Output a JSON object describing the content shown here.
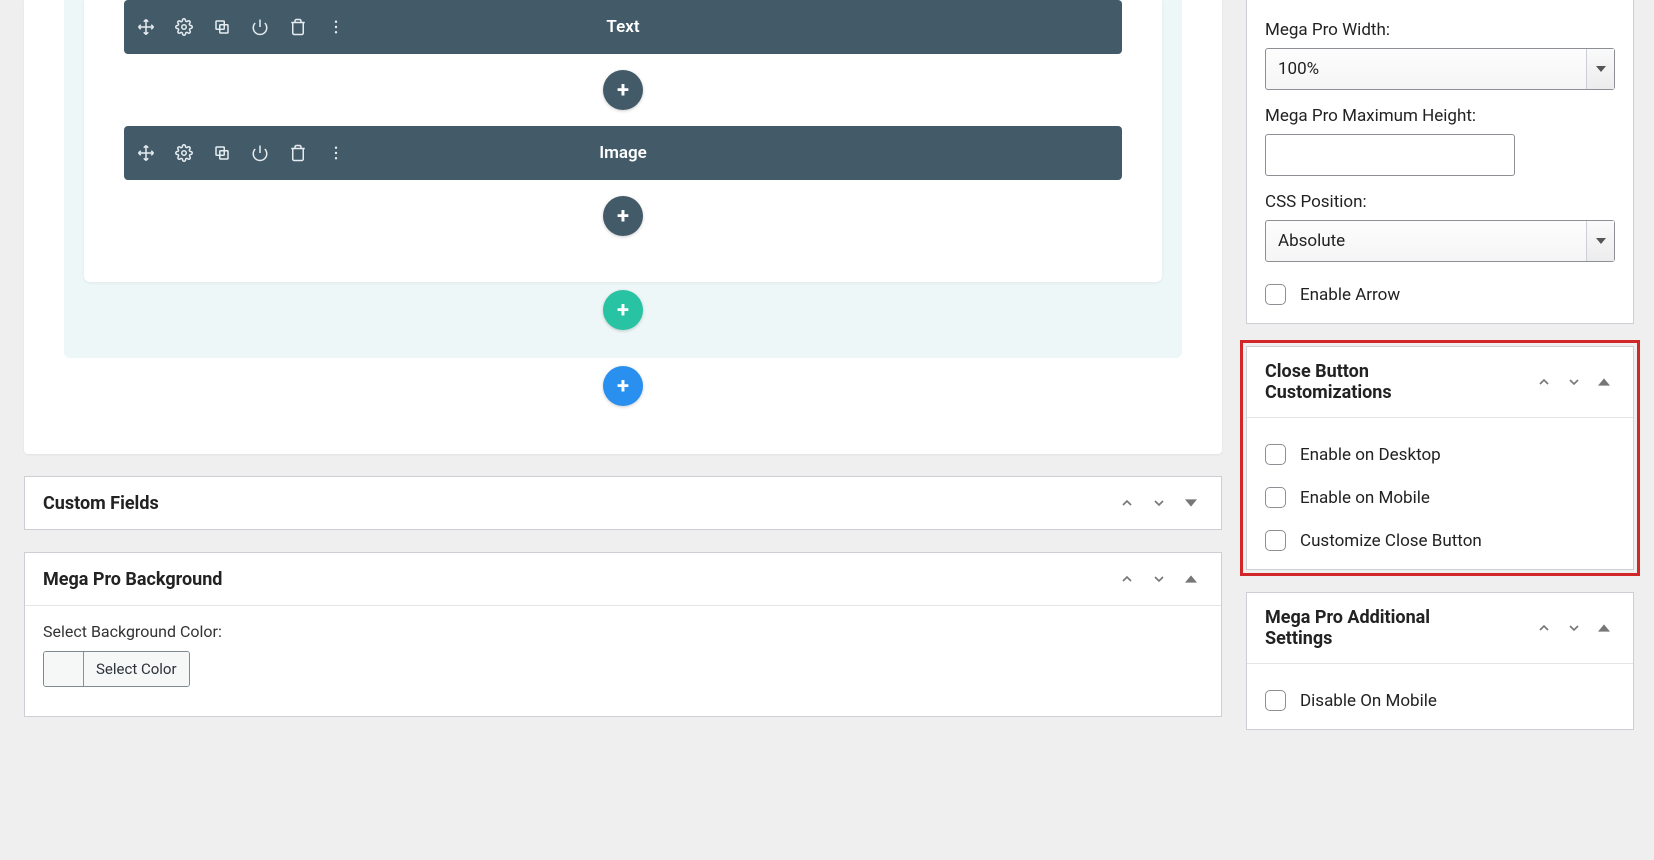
{
  "canvas": {
    "blocks": [
      {
        "label": "Text"
      },
      {
        "label": "Image"
      }
    ]
  },
  "metaboxes": {
    "custom_fields": {
      "title": "Custom Fields"
    },
    "mega_pro_bg": {
      "title": "Mega Pro Background",
      "field_label": "Select Background Color:",
      "color_button": "Select Color"
    }
  },
  "sidebar": {
    "settings_top": {
      "width_label": "Mega Pro Width:",
      "width_value": "100%",
      "maxheight_label": "Mega Pro Maximum Height:",
      "maxheight_value": "",
      "css_position_label": "CSS Position:",
      "css_position_value": "Absolute",
      "enable_arrow_label": "Enable Arrow"
    },
    "close_button": {
      "title": "Close Button Customizations",
      "enable_desktop": "Enable on Desktop",
      "enable_mobile": "Enable on Mobile",
      "customize": "Customize Close Button"
    },
    "additional": {
      "title": "Mega Pro Additional Settings",
      "disable_mobile": "Disable On Mobile"
    }
  }
}
